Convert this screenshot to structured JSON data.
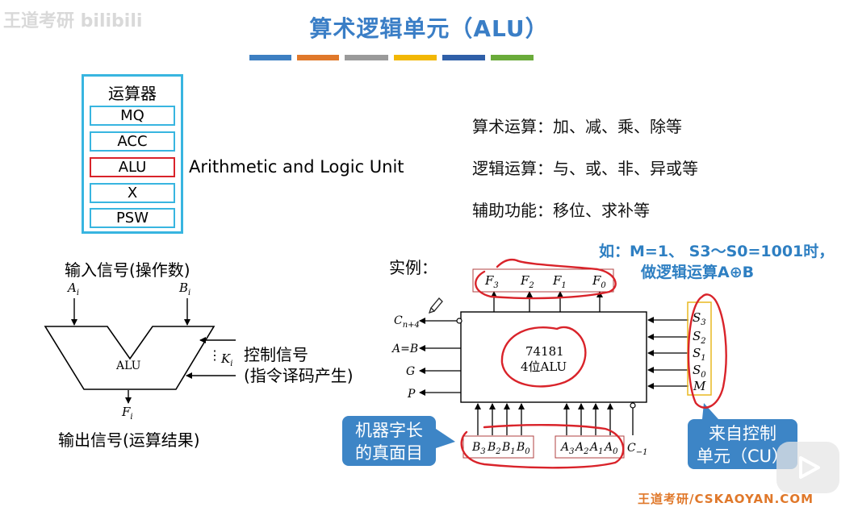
{
  "watermark": "王道考研 bilibili",
  "title": "算术逻辑单元（ALU）",
  "colors": {
    "title": "#3a7ec6",
    "bar": [
      "#3d7fc2",
      "#e0782a",
      "#9a9a9a",
      "#f2b705",
      "#2f5fa8",
      "#6aab3a"
    ],
    "box_border": "#38b5e0",
    "highlight": "#d9232a",
    "callout": "#3d85c6"
  },
  "calculator": {
    "title": "运算器",
    "registers": [
      "MQ",
      "ACC",
      "ALU",
      "X",
      "PSW"
    ],
    "alu_full_name": "Arithmetic and Logic Unit"
  },
  "functions": [
    "算术运算：加、减、乘、除等",
    "逻辑运算：与、或、非、异或等",
    "辅助功能：移位、求补等"
  ],
  "alu_diagram": {
    "input_label": "输入信号(操作数)",
    "input_a": "A",
    "input_a_sub": "i",
    "input_b": "B",
    "input_b_sub": "i",
    "alu_label": "ALU",
    "control_k": "K",
    "control_k_sub": "i",
    "control_label_1": "控制信号",
    "control_label_2": "(指令译码产生)",
    "output_f": "F",
    "output_f_sub": "i",
    "output_label": "输出信号(运算结果)"
  },
  "example": {
    "label": "实例：",
    "note_line1": "如：M=1、 S3～S0=1001时，",
    "note_line2": "做逻辑运算A⊕B",
    "chip_line1": "74181",
    "chip_line2": "4位ALU",
    "outputs_top": [
      "F3",
      "F2",
      "F1",
      "F0"
    ],
    "outputs_left": [
      "Cn+4",
      "A=B",
      "G",
      "P"
    ],
    "inputs_right": [
      "S3",
      "S2",
      "S1",
      "S0",
      "M"
    ],
    "inputs_bottom_b": [
      "B3",
      "B2",
      "B1",
      "B0"
    ],
    "inputs_bottom_a": [
      "A3",
      "A2",
      "A1",
      "A0"
    ],
    "carry_in": "C−1",
    "callout_left": [
      "机器字长",
      "的真面目"
    ],
    "callout_right": [
      "来自控制",
      "单元（CU）"
    ]
  },
  "footer": "王道考研/CSKAOYAN.COM"
}
